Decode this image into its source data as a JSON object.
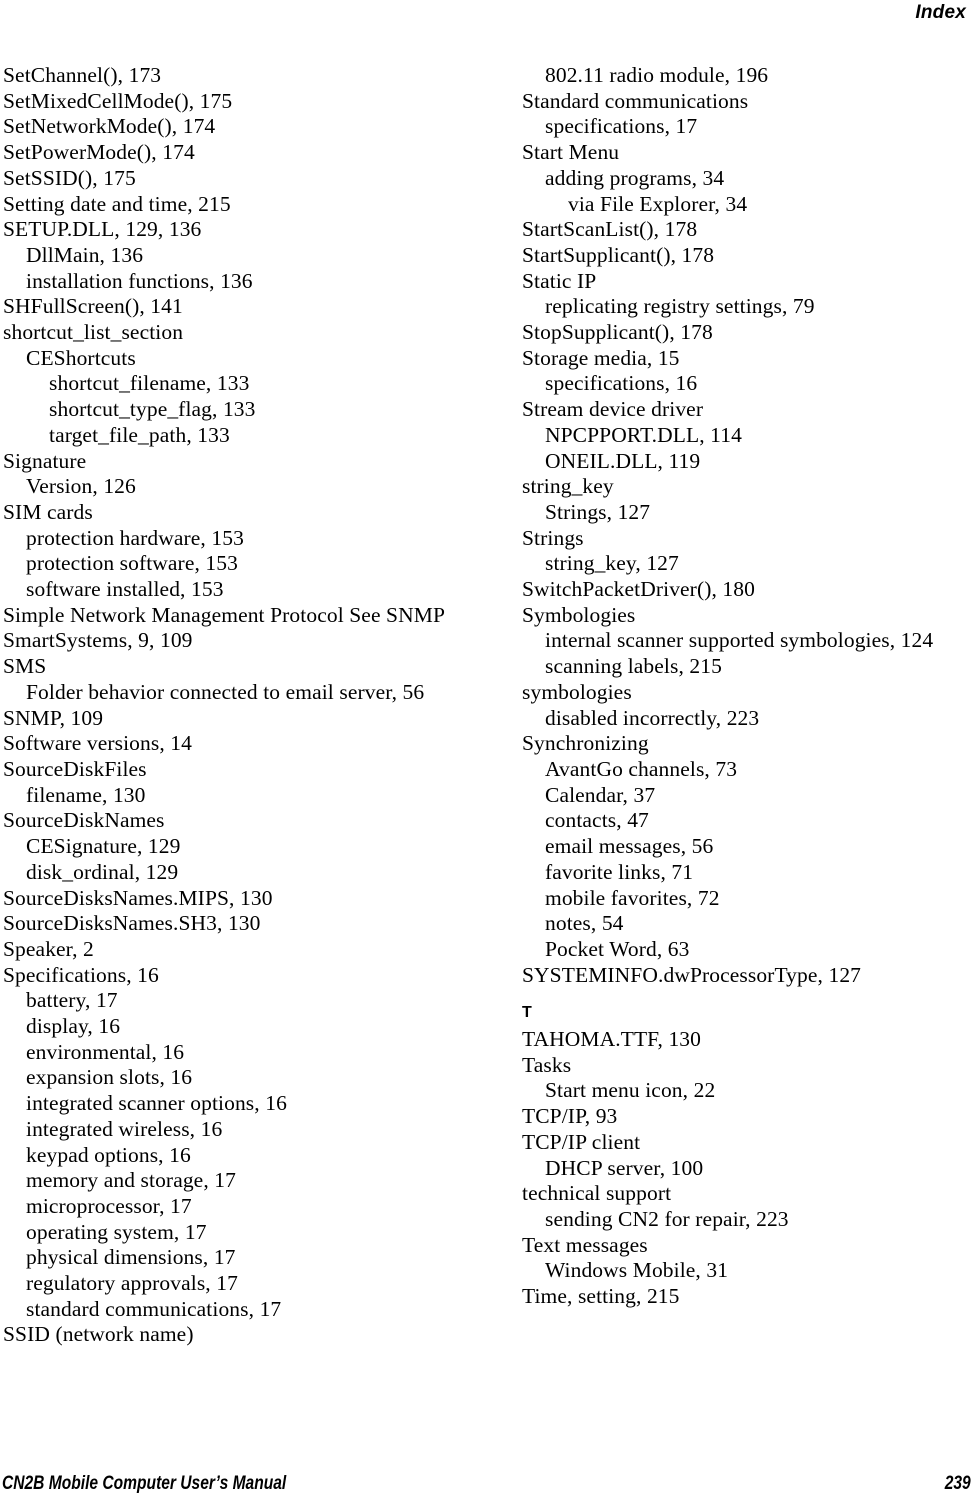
{
  "header": {
    "running_head": "Index"
  },
  "footer": {
    "manual_title": "CN2B Mobile Computer User’s Manual",
    "page_number": "239"
  },
  "columns": {
    "left": [
      {
        "level": 0,
        "text": "SetChannel(), 173"
      },
      {
        "level": 0,
        "text": "SetMixedCellMode(), 175"
      },
      {
        "level": 0,
        "text": "SetNetworkMode(), 174"
      },
      {
        "level": 0,
        "text": "SetPowerMode(), 174"
      },
      {
        "level": 0,
        "text": "SetSSID(), 175"
      },
      {
        "level": 0,
        "text": "Setting date and time, 215"
      },
      {
        "level": 0,
        "text": "SETUP.DLL, 129, 136"
      },
      {
        "level": 1,
        "text": "DllMain, 136"
      },
      {
        "level": 1,
        "text": "installation functions, 136"
      },
      {
        "level": 0,
        "text": "SHFullScreen(), 141"
      },
      {
        "level": 0,
        "text": "shortcut_list_section"
      },
      {
        "level": 1,
        "text": "CEShortcuts"
      },
      {
        "level": 2,
        "text": "shortcut_filename, 133"
      },
      {
        "level": 2,
        "text": "shortcut_type_flag, 133"
      },
      {
        "level": 2,
        "text": "target_file_path, 133"
      },
      {
        "level": 0,
        "text": "Signature"
      },
      {
        "level": 1,
        "text": "Version, 126"
      },
      {
        "level": 0,
        "text": "SIM cards"
      },
      {
        "level": 1,
        "text": "protection hardware, 153"
      },
      {
        "level": 1,
        "text": "protection software, 153"
      },
      {
        "level": 1,
        "text": "software installed, 153"
      },
      {
        "level": 0,
        "text": "Simple Network Management Protocol See SNMP"
      },
      {
        "level": 0,
        "text": "SmartSystems, 9, 109"
      },
      {
        "level": 0,
        "text": "SMS"
      },
      {
        "level": 1,
        "text": "Folder behavior connected to email server, 56"
      },
      {
        "level": 0,
        "text": "SNMP, 109"
      },
      {
        "level": 0,
        "text": "Software versions, 14"
      },
      {
        "level": 0,
        "text": "SourceDiskFiles"
      },
      {
        "level": 1,
        "text": "filename, 130"
      },
      {
        "level": 0,
        "text": "SourceDiskNames"
      },
      {
        "level": 1,
        "text": "CESignature, 129"
      },
      {
        "level": 1,
        "text": "disk_ordinal, 129"
      },
      {
        "level": 0,
        "text": "SourceDisksNames.MIPS, 130"
      },
      {
        "level": 0,
        "text": "SourceDisksNames.SH3, 130"
      },
      {
        "level": 0,
        "text": "Speaker, 2"
      },
      {
        "level": 0,
        "text": "Specifications, 16"
      },
      {
        "level": 1,
        "text": "battery, 17"
      },
      {
        "level": 1,
        "text": "display, 16"
      },
      {
        "level": 1,
        "text": "environmental, 16"
      },
      {
        "level": 1,
        "text": "expansion slots, 16"
      },
      {
        "level": 1,
        "text": "integrated scanner options, 16"
      },
      {
        "level": 1,
        "text": "integrated wireless, 16"
      },
      {
        "level": 1,
        "text": "keypad options, 16"
      },
      {
        "level": 1,
        "text": "memory and storage, 17"
      },
      {
        "level": 1,
        "text": "microprocessor, 17"
      },
      {
        "level": 1,
        "text": "operating system, 17"
      },
      {
        "level": 1,
        "text": "physical dimensions, 17"
      },
      {
        "level": 1,
        "text": "regulatory approvals, 17"
      },
      {
        "level": 1,
        "text": "standard communications, 17"
      },
      {
        "level": 0,
        "text": "SSID (network name)"
      }
    ],
    "right": [
      {
        "level": 1,
        "text": "802.11 radio module, 196"
      },
      {
        "level": 0,
        "text": "Standard communications"
      },
      {
        "level": 1,
        "text": "specifications, 17"
      },
      {
        "level": 0,
        "text": "Start Menu"
      },
      {
        "level": 1,
        "text": "adding programs, 34"
      },
      {
        "level": 2,
        "text": "via File Explorer, 34"
      },
      {
        "level": 0,
        "text": "StartScanList(), 178"
      },
      {
        "level": 0,
        "text": "StartSupplicant(), 178"
      },
      {
        "level": 0,
        "text": "Static IP"
      },
      {
        "level": 1,
        "text": "replicating registry settings, 79"
      },
      {
        "level": 0,
        "text": "StopSupplicant(), 178"
      },
      {
        "level": 0,
        "text": "Storage media, 15"
      },
      {
        "level": 1,
        "text": "specifications, 16"
      },
      {
        "level": 0,
        "text": "Stream device driver"
      },
      {
        "level": 1,
        "text": "NPCPPORT.DLL, 114"
      },
      {
        "level": 1,
        "text": "ONEIL.DLL, 119"
      },
      {
        "level": 0,
        "text": "string_key"
      },
      {
        "level": 1,
        "text": "Strings, 127"
      },
      {
        "level": 0,
        "text": "Strings"
      },
      {
        "level": 1,
        "text": "string_key, 127"
      },
      {
        "level": 0,
        "text": "SwitchPacketDriver(), 180"
      },
      {
        "level": 0,
        "text": "Symbologies"
      },
      {
        "level": 1,
        "text": "internal scanner supported symbologies, 124"
      },
      {
        "level": 1,
        "text": "scanning labels, 215"
      },
      {
        "level": 0,
        "text": "symbologies"
      },
      {
        "level": 1,
        "text": "disabled incorrectly, 223"
      },
      {
        "level": 0,
        "text": "Synchronizing"
      },
      {
        "level": 1,
        "text": "AvantGo channels, 73"
      },
      {
        "level": 1,
        "text": "Calendar, 37"
      },
      {
        "level": 1,
        "text": "contacts, 47"
      },
      {
        "level": 1,
        "text": "email messages, 56"
      },
      {
        "level": 1,
        "text": "favorite links, 71"
      },
      {
        "level": 1,
        "text": "mobile favorites, 72"
      },
      {
        "level": 1,
        "text": "notes, 54"
      },
      {
        "level": 1,
        "text": "Pocket Word, 63"
      },
      {
        "level": 0,
        "text": "SYSTEMINFO.dwProcessorType, 127"
      },
      {
        "level": 0,
        "text": "T",
        "section_letter": true
      },
      {
        "level": 0,
        "text": "TAHOMA.TTF, 130"
      },
      {
        "level": 0,
        "text": "Tasks"
      },
      {
        "level": 1,
        "text": "Start menu icon, 22"
      },
      {
        "level": 0,
        "text": "TCP/IP, 93"
      },
      {
        "level": 0,
        "text": "TCP/IP client"
      },
      {
        "level": 1,
        "text": "DHCP server, 100"
      },
      {
        "level": 0,
        "text": "technical support"
      },
      {
        "level": 1,
        "text": "sending CN2 for repair, 223"
      },
      {
        "level": 0,
        "text": "Text messages"
      },
      {
        "level": 1,
        "text": "Windows Mobile, 31"
      },
      {
        "level": 0,
        "text": "Time, setting, 215"
      }
    ]
  }
}
